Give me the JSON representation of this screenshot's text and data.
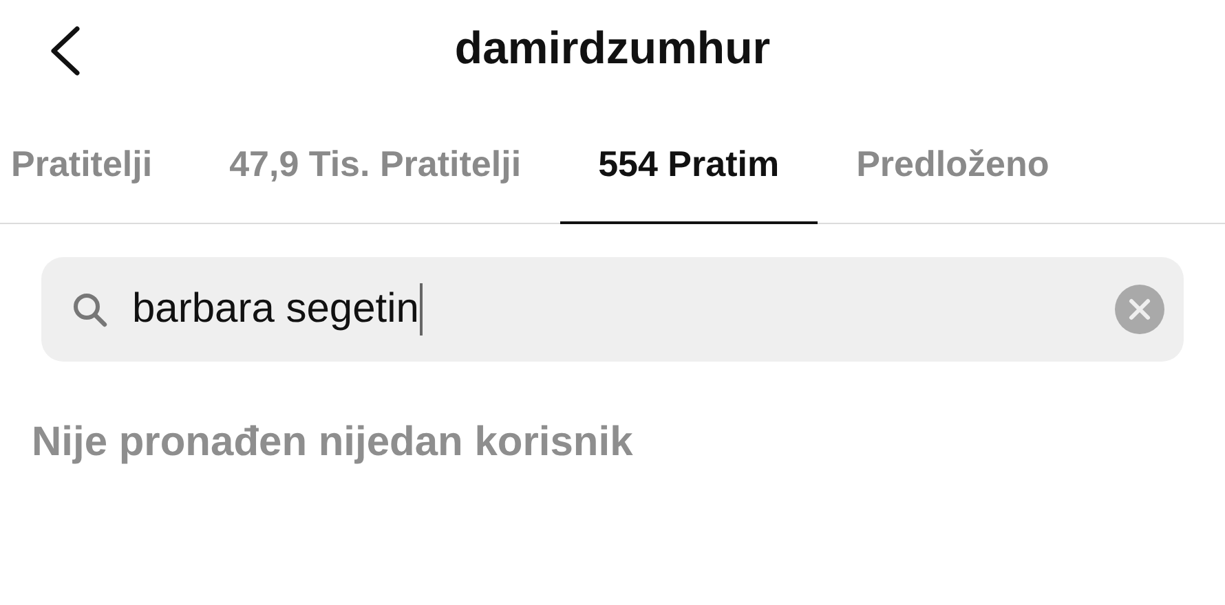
{
  "header": {
    "title": "damirdzumhur"
  },
  "tabs": [
    {
      "label": "Pratitelji",
      "selected": false
    },
    {
      "label": "47,9 Tis. Pratitelji",
      "selected": false
    },
    {
      "label": "554 Pratim",
      "selected": true
    },
    {
      "label": "Predloženo",
      "selected": false
    }
  ],
  "search": {
    "value": "barbara segetin"
  },
  "empty_message": "Nije pronađen nijedan korisnik"
}
